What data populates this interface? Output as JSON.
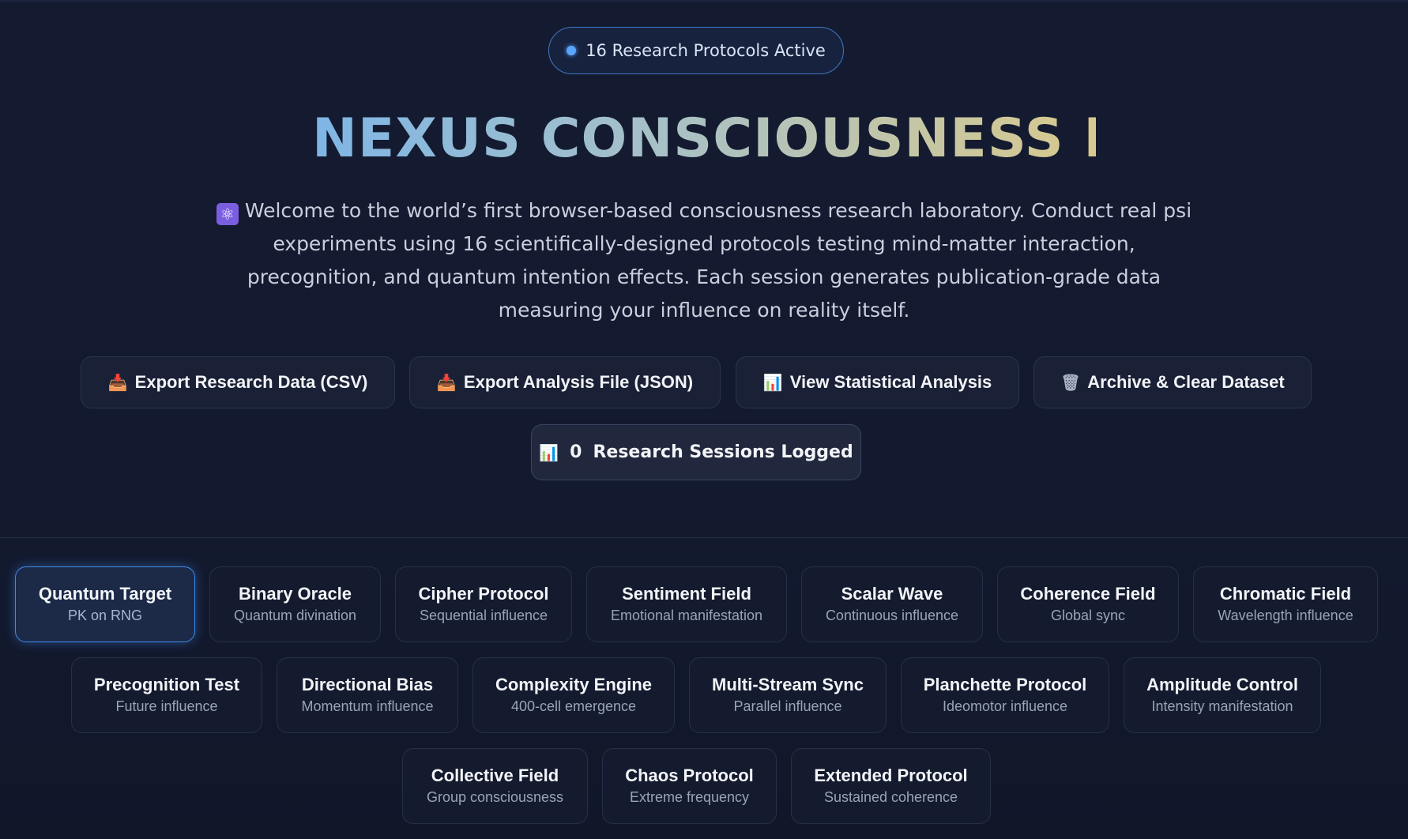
{
  "badge": {
    "text": "16 Research Protocols Active"
  },
  "title": "NEXUS CONSCIOUSNESS LAB",
  "intro": {
    "icon": "atom-icon",
    "text": "Welcome to the world’s first browser-based consciousness research laboratory. Conduct real psi experiments using 16 scientifically-designed protocols testing mind-matter interaction, precognition, and quantum intention effects. Each session generates publication-grade data measuring your influence on reality itself."
  },
  "actions": {
    "export_csv": "Export Research Data (CSV)",
    "export_json": "Export Analysis File (JSON)",
    "view_stats": "View Statistical Analysis",
    "archive": "Archive & Clear Dataset"
  },
  "sessions": {
    "count": "0",
    "label": "Research Sessions Logged"
  },
  "protocols": [
    {
      "name": "Quantum Target",
      "sub": "PK on RNG",
      "active": true
    },
    {
      "name": "Binary Oracle",
      "sub": "Quantum divination"
    },
    {
      "name": "Cipher Protocol",
      "sub": "Sequential influence"
    },
    {
      "name": "Sentiment Field",
      "sub": "Emotional manifestation"
    },
    {
      "name": "Scalar Wave",
      "sub": "Continuous influence"
    },
    {
      "name": "Coherence Field",
      "sub": "Global sync"
    },
    {
      "name": "Chromatic Field",
      "sub": "Wavelength influence"
    },
    {
      "name": "Precognition Test",
      "sub": "Future influence"
    },
    {
      "name": "Directional Bias",
      "sub": "Momentum influence"
    },
    {
      "name": "Complexity Engine",
      "sub": "400-cell emergence"
    },
    {
      "name": "Multi-Stream Sync",
      "sub": "Parallel influence"
    },
    {
      "name": "Planchette Protocol",
      "sub": "Ideomotor influence"
    },
    {
      "name": "Amplitude Control",
      "sub": "Intensity manifestation"
    },
    {
      "name": "Collective Field",
      "sub": "Group consciousness"
    },
    {
      "name": "Chaos Protocol",
      "sub": "Extreme frequency"
    },
    {
      "name": "Extended Protocol",
      "sub": "Sustained coherence"
    }
  ],
  "colors": {
    "accent": "#3f8ae8",
    "background": "#131a2f",
    "card": "#141b2e"
  }
}
